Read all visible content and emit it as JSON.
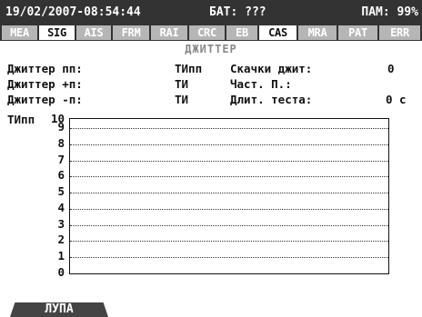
{
  "status": {
    "datetime": "19/02/2007-08:54:44",
    "battery": "БАТ: ???",
    "memory": "ПАМ: 99%"
  },
  "tabs": [
    {
      "label": "MEA",
      "active": false
    },
    {
      "label": "SIG",
      "active": true
    },
    {
      "label": "AIS",
      "active": false
    },
    {
      "label": "FRM",
      "active": false
    },
    {
      "label": "RAI",
      "active": false
    },
    {
      "label": "CRC",
      "active": false
    },
    {
      "label": "EB",
      "active": false
    },
    {
      "label": "CAS",
      "active": true
    },
    {
      "label": "MRA",
      "active": false
    },
    {
      "label": "PAT",
      "active": false
    },
    {
      "label": "ERR",
      "active": false
    }
  ],
  "screen_title": "ДЖИТТЕР",
  "measurements": {
    "jitter_pp_label": "Джиттер пп:",
    "jitter_pp_unit": "ТИпп",
    "jitter_plus_label": "Джиттер +п:",
    "jitter_plus_unit": "ТИ",
    "jitter_minus_label": "Джиттер -п:",
    "jitter_minus_unit": "ТИ",
    "jumps_label": "Скачки джит:",
    "jumps_value": "0",
    "freq_label": "Част. П.:",
    "freq_value": "",
    "duration_label": "Длит. теста:",
    "duration_value": "0 с"
  },
  "chart_data": {
    "type": "line",
    "ylabel": "ТИпп",
    "ylim": [
      0,
      10
    ],
    "yticks": [
      "10",
      "9",
      "8",
      "7",
      "6",
      "5",
      "4",
      "3",
      "2",
      "1",
      "0"
    ],
    "series": [],
    "grid": true
  },
  "softkey": {
    "label": "ЛУПА"
  },
  "colors": {
    "bar_bg": "#333333",
    "tab_inactive": "#b6b6b6",
    "tab_active": "#ffffff"
  }
}
